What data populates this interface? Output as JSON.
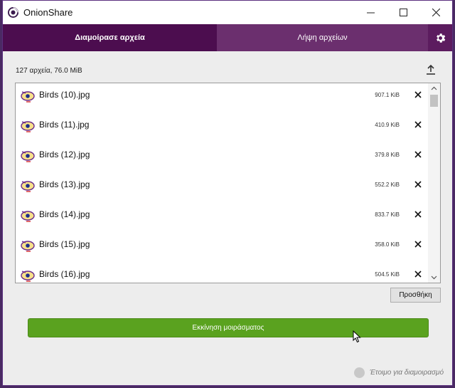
{
  "window": {
    "title": "OnionShare"
  },
  "tabs": {
    "share_label": "Διαμοίρασε αρχεία",
    "receive_label": "Λήψη αρχείων"
  },
  "summary": "127 αρχεία, 76.0 MiB",
  "files": [
    {
      "name": "Birds (10).jpg",
      "size": "907.1 KiB"
    },
    {
      "name": "Birds (11).jpg",
      "size": "410.9 KiB"
    },
    {
      "name": "Birds (12).jpg",
      "size": "379.8 KiB"
    },
    {
      "name": "Birds (13).jpg",
      "size": "552.2 KiB"
    },
    {
      "name": "Birds (14).jpg",
      "size": "833.7 KiB"
    },
    {
      "name": "Birds (15).jpg",
      "size": "358.0 KiB"
    },
    {
      "name": "Birds (16).jpg",
      "size": "504.5 KiB"
    }
  ],
  "buttons": {
    "add_label": "Προσθήκη",
    "start_label": "Εκκίνηση μοιράσματος"
  },
  "status": {
    "text": "Έτοιμο για διαμοιρασμό"
  },
  "colors": {
    "accent_purple": "#5c1c5f",
    "active_tab": "#4c0d4f",
    "start_green": "#5aa21f"
  },
  "icons": {
    "app": "onionshare-logo-icon",
    "settings": "gear-icon",
    "upload": "upload-icon",
    "file": "image-file-icon",
    "delete": "close-icon"
  }
}
